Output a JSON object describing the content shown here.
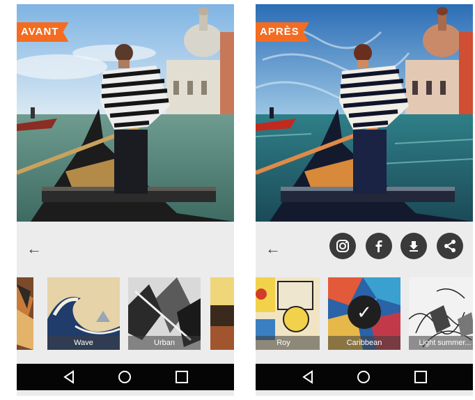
{
  "before": {
    "badge": "AVANT",
    "thumbnails": [
      {
        "label": ""
      },
      {
        "label": "Wave"
      },
      {
        "label": "Urban"
      },
      {
        "label": ""
      }
    ]
  },
  "after": {
    "badge": "APRÈS",
    "share_icons": [
      "instagram-icon",
      "facebook-icon",
      "download-icon",
      "share-icon"
    ],
    "thumbnails": [
      {
        "label": "Roy"
      },
      {
        "label": "Caribbean",
        "selected": true
      },
      {
        "label": "Light summer..."
      }
    ]
  },
  "navbar": {
    "icons": [
      "back-triangle-icon",
      "home-circle-icon",
      "recents-square-icon"
    ]
  },
  "colors": {
    "badge": "#f36c21",
    "navbar": "#050505",
    "panel": "#ececec",
    "button": "#3a3a3a"
  }
}
